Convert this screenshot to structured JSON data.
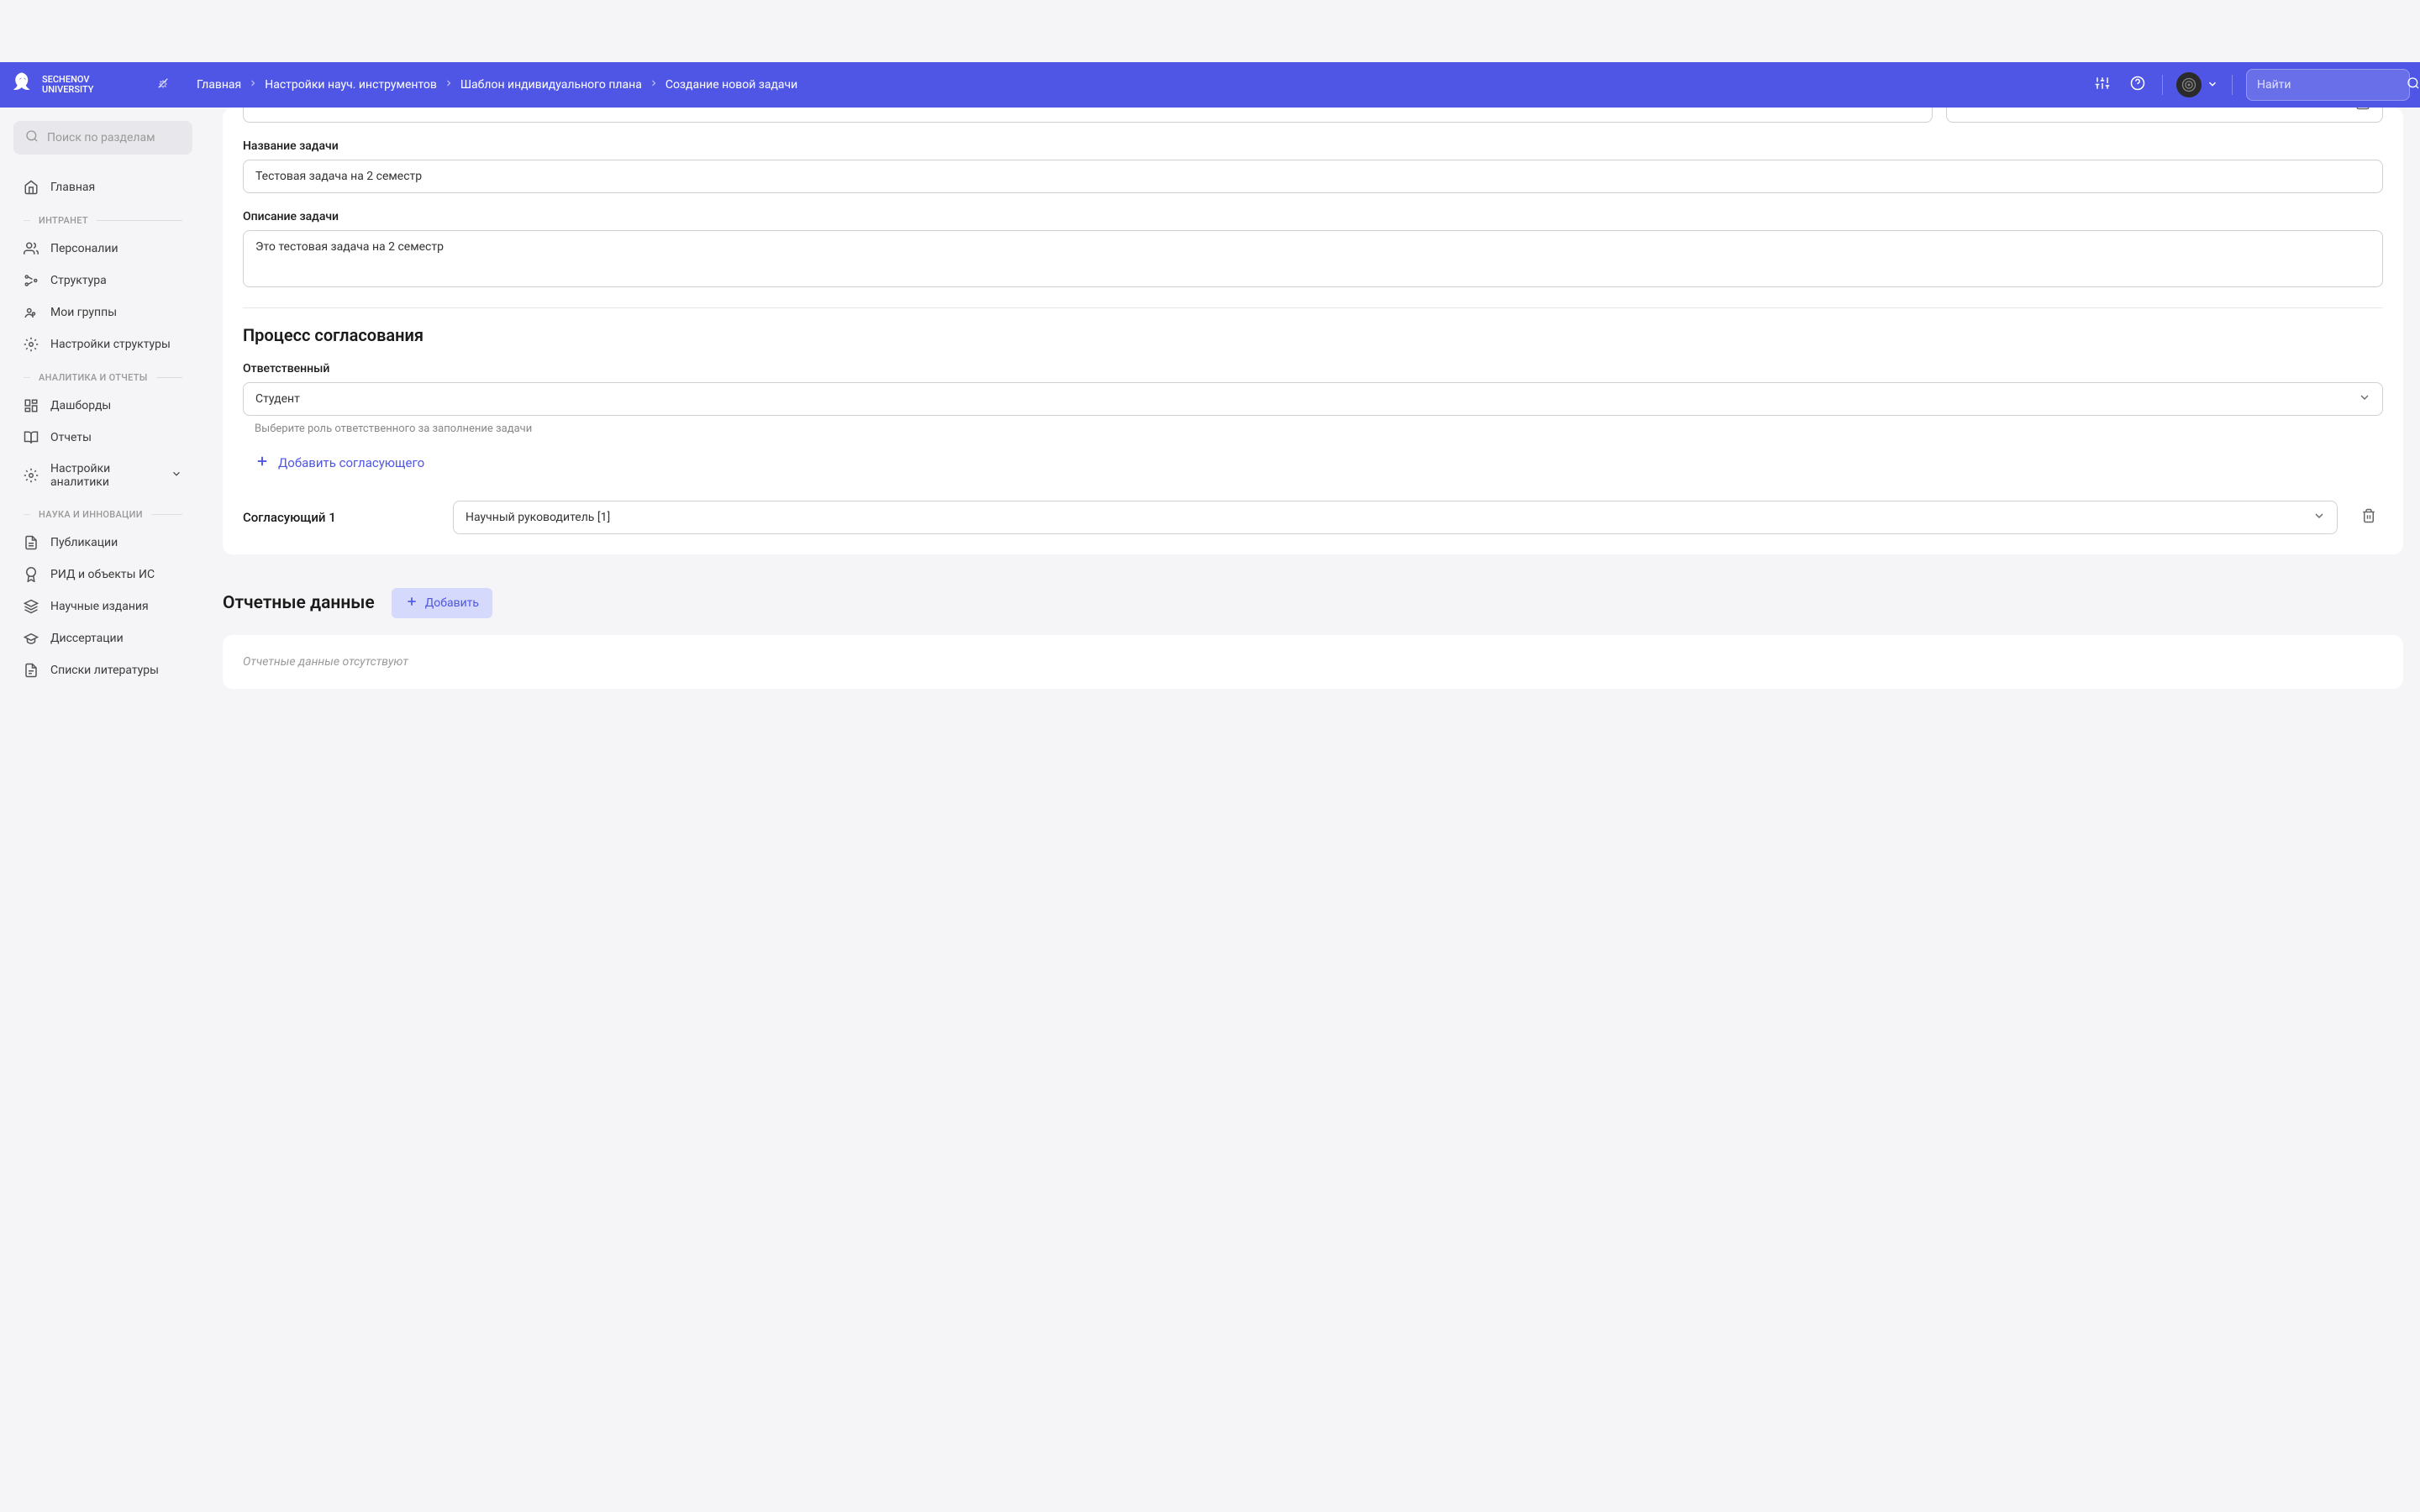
{
  "header": {
    "logo_text": "SECHENOV\nUNIVERSITY",
    "search_placeholder": "Найти",
    "breadcrumbs": [
      "Главная",
      "Настройки науч. инструментов",
      "Шаблон индивидуального плана",
      "Создание новой задачи"
    ]
  },
  "sidebar": {
    "search_placeholder": "Поиск по разделам",
    "items": {
      "main": "Главная"
    },
    "sections": {
      "intranet": {
        "title": "ИНТРАНЕТ",
        "items": {
          "personalii": "Персоналии",
          "structure": "Структура",
          "groups": "Мои группы",
          "settings": "Настройки структуры"
        }
      },
      "analytics": {
        "title": "АНАЛИТИКА И ОТЧЕТЫ",
        "items": {
          "dashboards": "Дашборды",
          "reports": "Отчеты",
          "settings": "Настройки аналитики"
        }
      },
      "science": {
        "title": "НАУКА И ИННОВАЦИИ",
        "items": {
          "publications": "Публикации",
          "rid": "РИД и объекты ИС",
          "editions": "Научные издания",
          "dissertations": "Диссертации",
          "bibliography": "Списки литературы"
        }
      }
    }
  },
  "form": {
    "task_name_label": "Название задачи",
    "task_name_value": "Тестовая задача на 2 семестр",
    "task_desc_label": "Описание задачи",
    "task_desc_value": "Это тестовая задача на 2 семестр",
    "approval_title": "Процесс согласования",
    "responsible_label": "Ответственный",
    "responsible_value": "Студент",
    "responsible_hint": "Выберите роль ответственного за заполнение задачи",
    "add_approver": "Добавить согласующего",
    "approver_label": "Согласующий 1",
    "approver_value": "Научный руководитель [1]"
  },
  "report_section": {
    "title": "Отчетные данные",
    "add_btn": "Добавить",
    "empty_text": "Отчетные данные отсутствуют"
  }
}
